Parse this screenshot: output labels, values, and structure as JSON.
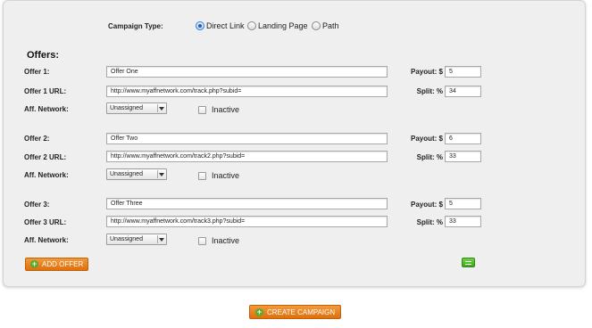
{
  "campaign_type": {
    "label": "Campaign Type:",
    "options": [
      "Direct Link",
      "Landing Page",
      "Path"
    ],
    "selected": "Direct Link"
  },
  "offers_heading": "Offers:",
  "offers": [
    {
      "name_label": "Offer 1:",
      "name": "Offer One",
      "url_label": "Offer 1 URL:",
      "url": "http://www.myaffnetwork.com/track.php?subid=",
      "network_label": "Aff. Network:",
      "network": "Unassigned",
      "inactive_label": "Inactive",
      "inactive": false,
      "payout_label": "Payout: $",
      "payout": "5",
      "split_label": "Split: %",
      "split": "34"
    },
    {
      "name_label": "Offer 2:",
      "name": "Offer Two",
      "url_label": "Offer 2 URL:",
      "url": "http://www.myaffnetwork.com/track2.php?subid=",
      "network_label": "Aff. Network:",
      "network": "Unassigned",
      "inactive_label": "Inactive",
      "inactive": false,
      "payout_label": "Payout: $",
      "payout": "6",
      "split_label": "Split: %",
      "split": "33"
    },
    {
      "name_label": "Offer 3:",
      "name": "Offer Three",
      "url_label": "Offer 3 URL:",
      "url": "http://www.myaffnetwork.com/track3.php?subid=",
      "network_label": "Aff. Network:",
      "network": "Unassigned",
      "inactive_label": "Inactive",
      "inactive": false,
      "payout_label": "Payout: $",
      "payout": "5",
      "split_label": "Split: %",
      "split": "33"
    }
  ],
  "add_offer_label": "ADD OFFER",
  "create_campaign_label": "CREATE CAMPAIGN",
  "colors": {
    "panel_bg": "#efefef",
    "orange_button": "#e8821e",
    "green_button": "#4cb526",
    "radio_selected": "#1f5fbf"
  },
  "icons": {
    "add_offer": "plus-circle-icon",
    "create_campaign": "plus-circle-icon",
    "equalize": "equals-icon"
  }
}
